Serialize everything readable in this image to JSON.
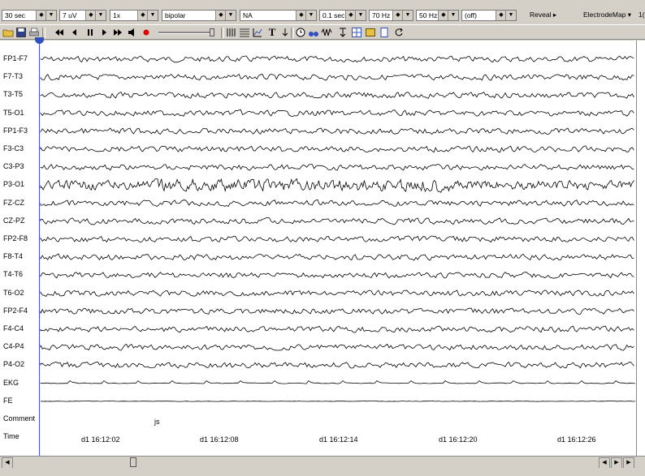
{
  "toolbar": {
    "timebase": "30 sec",
    "sensitivity": "7 uV",
    "speed": "1x",
    "montage": "bipolar",
    "reference": "NA",
    "low_filter": "0.1 sec",
    "high_filter": "70 Hz",
    "notch": "50 Hz",
    "extra": "(off)",
    "reveal_label": "Reveal ▸",
    "electrode_map_label": "ElectrodeMap ▾",
    "overflow": "1("
  },
  "channels": [
    "FP1-F7",
    "F7-T3",
    "T3-T5",
    "T5-O1",
    "FP1-F3",
    "F3-C3",
    "C3-P3",
    "P3-O1",
    "FZ-CZ",
    "CZ-PZ",
    "FP2-F8",
    "F8-T4",
    "T4-T6",
    "T6-O2",
    "FP2-F4",
    "F4-C4",
    "C4-P4",
    "P4-O2",
    "EKG",
    "FE",
    "Comment",
    "Time"
  ],
  "comment_text": "js",
  "timestamps": [
    "d1 16:12:02",
    "d1 16:12:08",
    "d1 16:12:14",
    "d1 16:12:20",
    "d1 16:12:26"
  ],
  "icons": {
    "open": "folder-icon",
    "save": "save-icon",
    "print": "printer-icon",
    "rewind": "rewind-icon",
    "step_back": "step-back-icon",
    "pause": "pause-icon",
    "play": "play-icon",
    "fast_forward": "fast-forward-icon",
    "speaker": "speaker-icon",
    "record": "record-icon"
  },
  "colors": {
    "cursor": "#4a4aff",
    "trace": "#000000",
    "record": "#e00000"
  }
}
